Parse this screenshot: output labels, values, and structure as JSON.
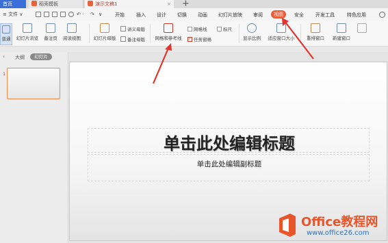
{
  "tabs": {
    "home": "首页",
    "template": "稻壳模板",
    "document": "演示文稿1",
    "add": "+"
  },
  "menubar": {
    "file": "≡ 文件 ∨",
    "items": [
      "开始",
      "插入",
      "设计",
      "切换",
      "动画",
      "幻灯片放映",
      "审阅",
      "视图",
      "安全",
      "开发工具",
      "特色应用"
    ],
    "active": "视图"
  },
  "ribbon": {
    "normal": "普通",
    "slide_sorter": "幻灯片浏览",
    "notes_page": "备注页",
    "reading_view": "阅读视图",
    "slide_master": "幻灯片母版",
    "handout_master": "讲义母版",
    "notes_master": "备注母版",
    "grid_guides": "网格和参考线",
    "gridlines": "网格线",
    "ruler": "标尺",
    "task_pane": "任务窗格",
    "zoom": "显示比例",
    "fit_window": "适应窗口大小",
    "arrange_window": "重排窗口",
    "new_window": "新建窗口"
  },
  "left_pane": {
    "outline_tab": "大纲",
    "slides_tab": "幻灯片",
    "slide_number": "1"
  },
  "slide": {
    "title": "单击此处编辑标题",
    "subtitle": "单击此处编辑副标题"
  },
  "watermark": {
    "title": "Office教程网",
    "url": "www.office26.com"
  },
  "colors": {
    "accent": "#e85c3a",
    "tab_blue": "#3a6ed8",
    "annotation_red": "#e0342d"
  }
}
